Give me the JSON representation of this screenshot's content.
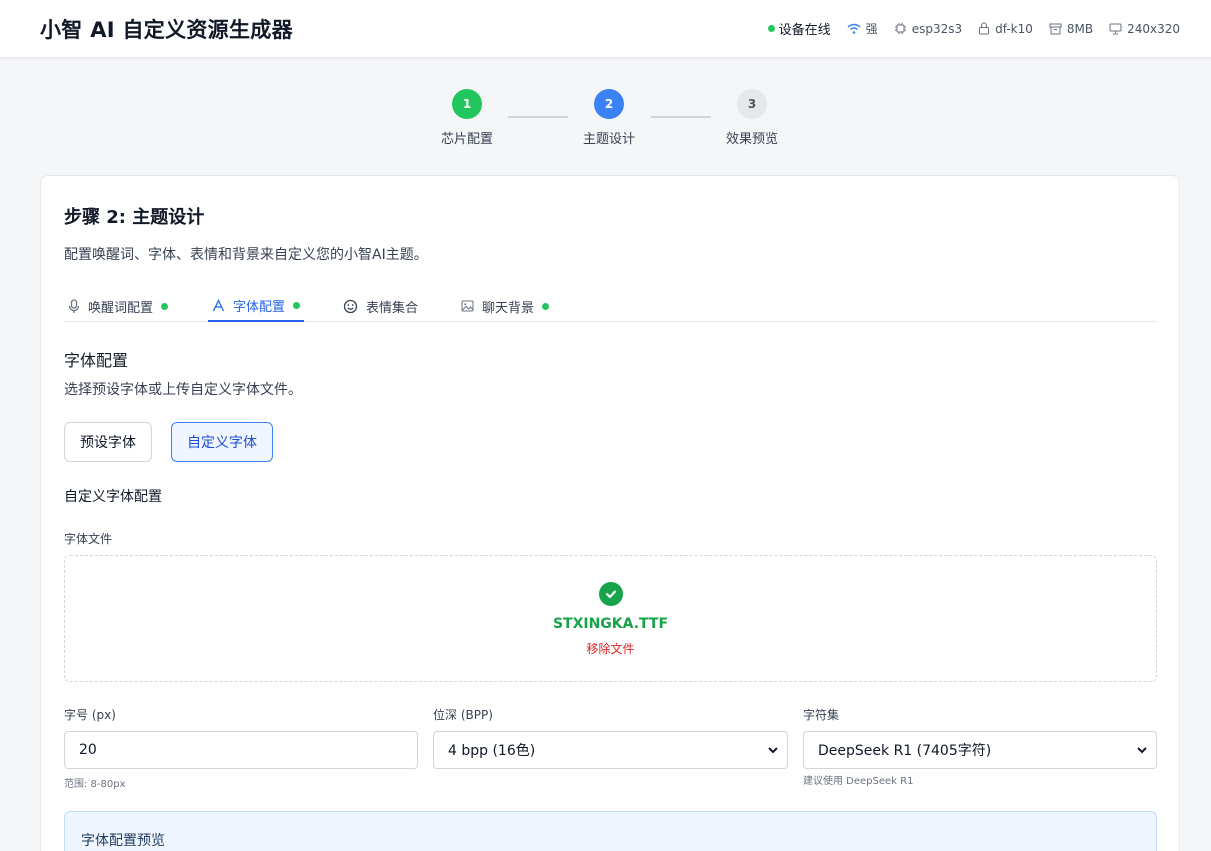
{
  "app": {
    "title": "小智 AI 自定义资源生成器"
  },
  "status": {
    "online": "设备在线",
    "wifi": "强",
    "chip": "esp32s3",
    "board": "df-k10",
    "flash": "8MB",
    "resolution": "240x320",
    "colors": {
      "online": "#22c55e",
      "accent": "#3b82f6"
    }
  },
  "steps": [
    {
      "number": "1",
      "label": "芯片配置",
      "state": "done"
    },
    {
      "number": "2",
      "label": "主题设计",
      "state": "active"
    },
    {
      "number": "3",
      "label": "效果预览",
      "state": "todo"
    }
  ],
  "card": {
    "title": "步骤 2: 主题设计",
    "description": "配置唤醒词、字体、表情和背景来自定义您的小智AI主题。"
  },
  "tabs": [
    {
      "label": "唤醒词配置",
      "icon": "microphone-icon",
      "done": true
    },
    {
      "label": "字体配置",
      "icon": "font-icon",
      "done": true,
      "active": true
    },
    {
      "label": "表情集合",
      "icon": "smile-icon",
      "done": false
    },
    {
      "label": "聊天背景",
      "icon": "image-icon",
      "done": true
    }
  ],
  "font_section": {
    "title": "字体配置",
    "description": "选择预设字体或上传自定义字体文件。",
    "preset_button": "预设字体",
    "custom_button": "自定义字体",
    "custom_title": "自定义字体配置",
    "file_label": "字体文件",
    "file_name": "STXINGKA.TTF",
    "remove_label": "移除文件",
    "size_label": "字号 (px)",
    "size_value": "20",
    "size_hint": "范围: 8-80px",
    "bpp_label": "位深 (BPP)",
    "bpp_value": "4 bpp (16色)",
    "charset_label": "字符集",
    "charset_value": "DeepSeek R1 (7405字符)",
    "charset_hint": "建议使用 DeepSeek R1",
    "preview_title": "字体配置预览"
  }
}
